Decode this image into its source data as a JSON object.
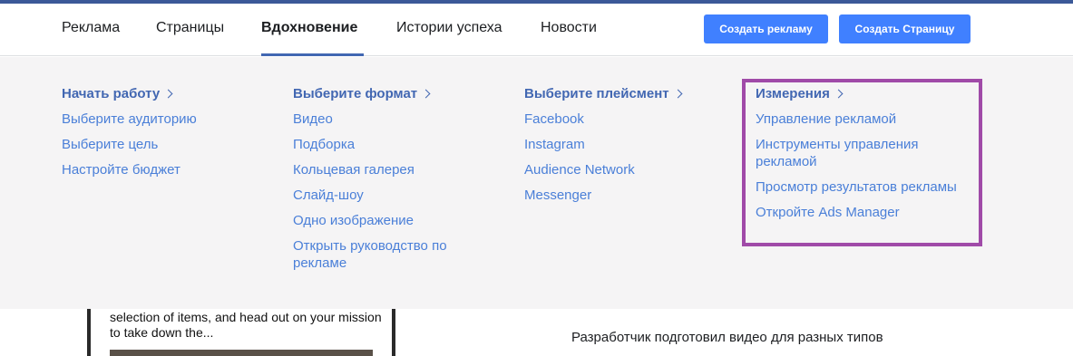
{
  "nav": {
    "items": [
      {
        "label": "Реклама"
      },
      {
        "label": "Страницы"
      },
      {
        "label": "Вдохновение",
        "active": true
      },
      {
        "label": "Истории успеха"
      },
      {
        "label": "Новости"
      }
    ],
    "buttons": {
      "create_ad": "Создать рекламу",
      "create_page": "Создать Страницу"
    }
  },
  "menu": {
    "columns": [
      {
        "heading": "Начать работу",
        "links": [
          "Выберите аудиторию",
          "Выберите цель",
          "Настройте бюджет"
        ]
      },
      {
        "heading": "Выберите формат",
        "links": [
          "Видео",
          "Подборка",
          "Кольцевая галерея",
          "Слайд-шоу",
          "Одно изображение",
          "Открыть руководство по рекламе"
        ]
      },
      {
        "heading": "Выберите плейсмент",
        "links": [
          "Facebook",
          "Instagram",
          "Audience Network",
          "Messenger"
        ]
      },
      {
        "heading": "Измерения",
        "links": [
          "Управление рекламой",
          "Инструменты управления рекламой",
          "Просмотр результатов рекламы",
          "Откройте Ads Manager"
        ]
      }
    ]
  },
  "content": {
    "phone_text": "selection of items, and head out on your mission to take down the...",
    "developer_text": "Разработчик подготовил видео для разных типов"
  },
  "colors": {
    "accent": "#4267b2",
    "button": "#4080ff",
    "highlight": "#a04aa8"
  }
}
